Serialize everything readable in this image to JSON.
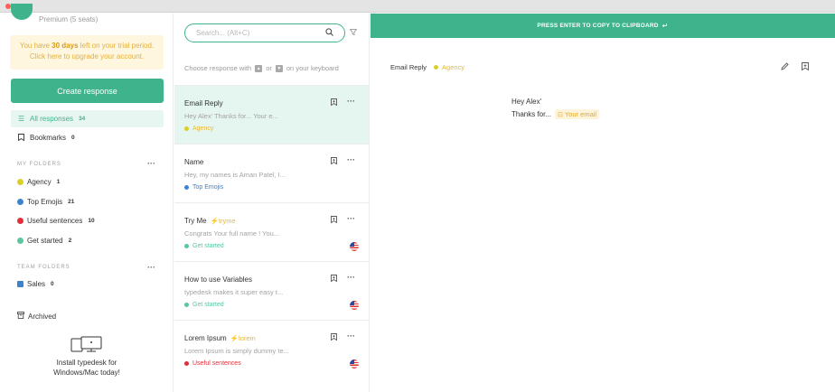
{
  "sidebar": {
    "plan": "Premium (5 seats)",
    "trial": {
      "prefix": "You have ",
      "days": "30 days",
      "suffix": " left on your trial period.",
      "line2": "Click here to upgrade your account."
    },
    "create_button": "Create response",
    "nav": [
      {
        "label": "All responses",
        "count": "34",
        "icon": "list-icon"
      },
      {
        "label": "Bookmarks",
        "count": "0",
        "icon": "bookmark-icon"
      }
    ],
    "my_folders_label": "MY FOLDERS",
    "my_folders": [
      {
        "label": "Agency",
        "count": "1",
        "color": "#d9cf2b"
      },
      {
        "label": "Top Emojis",
        "count": "21",
        "color": "#3b83d1"
      },
      {
        "label": "Useful sentences",
        "count": "10",
        "color": "#e0303c"
      },
      {
        "label": "Get started",
        "count": "2",
        "color": "#5ac79e"
      }
    ],
    "team_folders_label": "TEAM FOLDERS",
    "team_folders": [
      {
        "label": "Sales",
        "count": "0",
        "color": "#3b83d1"
      }
    ],
    "archived": "Archived",
    "install_line1": "Install typedesk for",
    "install_line2": "Windows/Mac today!"
  },
  "list": {
    "search_placeholder": "Search... (Alt+C)",
    "hint_prefix": "Choose response with",
    "hint_or": "or",
    "hint_suffix": "on your keyboard",
    "items": [
      {
        "title": "Email Reply",
        "tag": "",
        "preview": "Hey Alex' Thanks for... Your e...",
        "folder": "Agency",
        "folder_color": "#d9cf2b",
        "flag": false
      },
      {
        "title": "Name",
        "tag": "",
        "preview": "Hey, my names is Aman Patel, I...",
        "folder": "Top Emojis",
        "folder_color": "#3b83d1",
        "flag": false
      },
      {
        "title": "Try Me",
        "tag": "tryme",
        "preview": "Congrats Your full name ! You...",
        "folder": "Get started",
        "folder_color": "#5ac79e",
        "flag": true
      },
      {
        "title": "How to use Variables",
        "tag": "",
        "preview": "typedesk makes it super easy t...",
        "folder": "Get started",
        "folder_color": "#5ac79e",
        "flag": true
      },
      {
        "title": "Lorem Ipsum",
        "tag": "lorem",
        "preview": "Lorem Ipsum is simply dummy te...",
        "folder": "Useful sentences",
        "folder_color": "#e0303c",
        "flag": true
      }
    ]
  },
  "detail": {
    "copy_bar": "PRESS ENTER TO COPY TO CLIPBOARD",
    "title": "Email Reply",
    "folder": "Agency",
    "folder_color": "#d9cf2b",
    "line1": "Hey Alex'",
    "line2": "Thanks for...",
    "variable": "Your email"
  },
  "colors": {
    "accent": "#3fb38c",
    "warning": "#e7b935"
  }
}
